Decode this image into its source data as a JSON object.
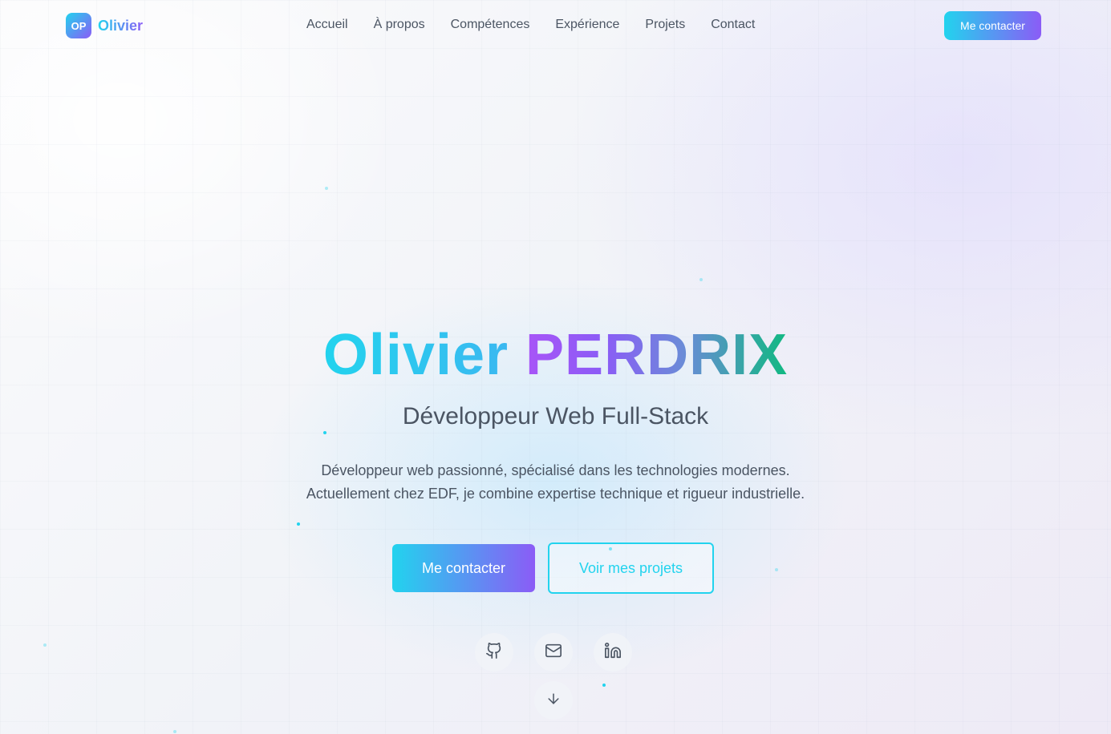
{
  "brand": {
    "badge": "OP",
    "name": "Olivier"
  },
  "nav": {
    "items": [
      {
        "label": "Accueil"
      },
      {
        "label": "À propos"
      },
      {
        "label": "Compétences"
      },
      {
        "label": "Expérience"
      },
      {
        "label": "Projets"
      },
      {
        "label": "Contact"
      }
    ],
    "cta_label": "Me contacter"
  },
  "hero": {
    "first_name": "Olivier",
    "last_name": "PERDRIX",
    "subtitle": "Développeur Web Full-Stack",
    "description_line1": "Développeur web passionné, spécialisé dans les technologies modernes.",
    "description_line2": "Actuellement chez EDF, je combine expertise technique et rigueur industrielle.",
    "primary_cta": "Me contacter",
    "secondary_cta": "Voir mes projets"
  },
  "social": [
    {
      "icon": "github-icon"
    },
    {
      "icon": "mail-icon"
    },
    {
      "icon": "linkedin-icon"
    }
  ],
  "scroll_icon": "arrow-down-icon",
  "colors": {
    "accent_cyan": "#22d3ee",
    "accent_violet": "#8b5cf6",
    "accent_green": "#10b981",
    "text": "#4b5563"
  }
}
